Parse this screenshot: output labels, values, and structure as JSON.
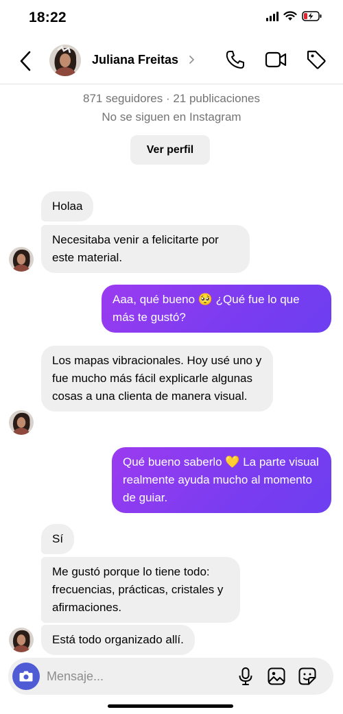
{
  "status_bar": {
    "time": "18:22"
  },
  "header": {
    "contact_name": "Juliana Freitas"
  },
  "profile": {
    "stats": "871 seguidores · 21 publicaciones",
    "relation": "No se siguen en Instagram",
    "view_profile_label": "Ver perfil"
  },
  "messages": [
    {
      "side": "received",
      "text": "Holaa"
    },
    {
      "side": "received",
      "text": "Necesitaba venir a felicitarte por este material."
    },
    {
      "side": "sent",
      "text": "Aaa, qué bueno 🥺 ¿Qué fue lo que más te gustó?"
    },
    {
      "side": "received",
      "text": "Los mapas vibracionales. Hoy usé uno y fue mucho más fácil explicarle algunas cosas a una clienta de manera visual."
    },
    {
      "side": "sent",
      "text": "Qué bueno saberlo 💛 La parte visual realmente ayuda mucho al momento de guiar."
    },
    {
      "side": "received",
      "text": "Sí"
    },
    {
      "side": "received",
      "text": "Me gustó porque lo tiene todo: frecuencias, prácticas, cristales y afirmaciones."
    },
    {
      "side": "received",
      "text": "Está todo organizado allí."
    }
  ],
  "composer": {
    "placeholder": "Mensaje..."
  },
  "icons": {
    "back": "chevron-left-icon",
    "call": "phone-icon",
    "video": "video-camera-icon",
    "tag": "tag-icon",
    "camera": "camera-icon",
    "mic": "microphone-icon",
    "gallery": "image-icon",
    "sticker": "sticker-icon"
  },
  "colors": {
    "sent_bubble_start": "#9b3bf0",
    "sent_bubble_end": "#6c3ff0",
    "received_bubble": "#efefef",
    "camera_button": "#4f5bd5"
  }
}
